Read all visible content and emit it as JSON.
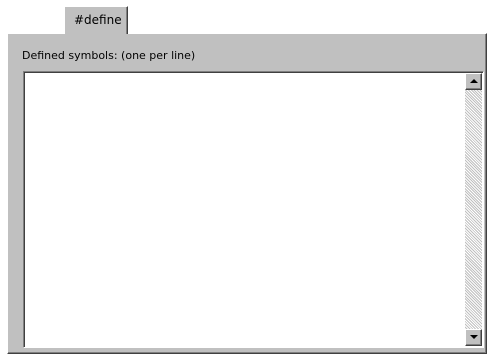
{
  "tab": {
    "label": "#define"
  },
  "field": {
    "label": "Defined symbols:  (one per line)",
    "value": ""
  },
  "scrollbar": {
    "up_icon": "scroll-up-arrow-icon",
    "down_icon": "scroll-down-arrow-icon"
  }
}
